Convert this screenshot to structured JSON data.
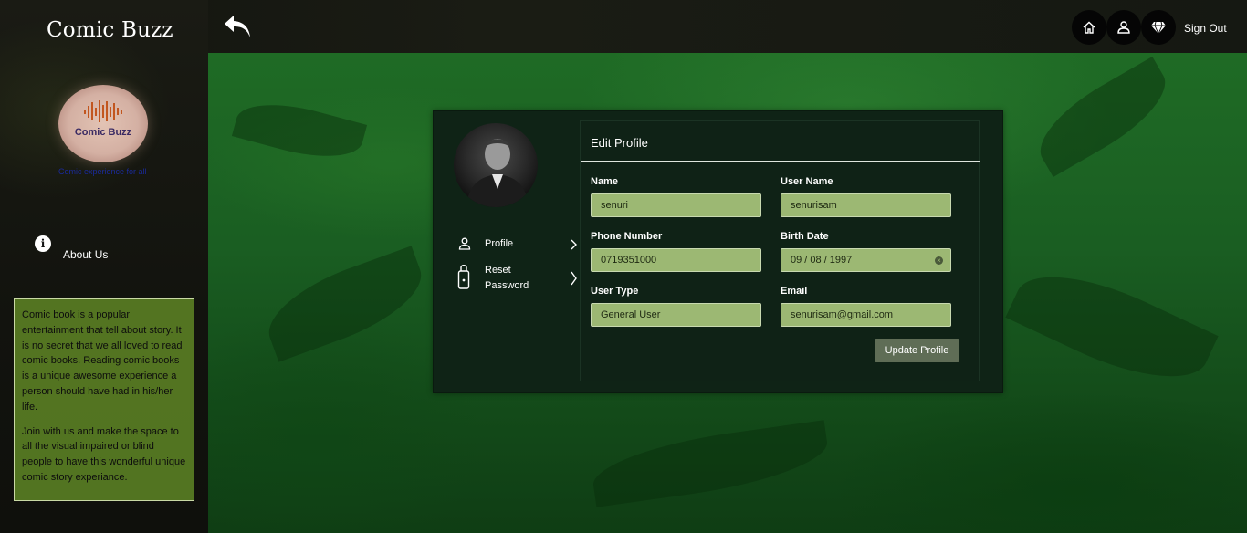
{
  "app": {
    "brand": "Comic Buzz",
    "logo_text": "Comic Buzz",
    "tagline": "Comic experience for all"
  },
  "topbar": {
    "sign_out_label": "Sign Out",
    "icons": [
      "back-arrow-icon",
      "home-icon",
      "user-icon",
      "diamond-icon"
    ]
  },
  "sidebar": {
    "about_label": "About Us",
    "about_paragraphs": [
      "Comic book is a popular entertainment that tell about story. It is no secret that we all loved to read comic books. Reading comic books is a unique awesome experience a person should have had in his/her life.",
      "Join with us and make the space to all the visual impaired or blind people to have this wonderful unique comic story experiance."
    ]
  },
  "profile_menu": {
    "items": [
      {
        "label": "Profile",
        "icon": "user-icon"
      },
      {
        "label": "Reset Password",
        "icon": "lock-icon"
      }
    ]
  },
  "edit_profile": {
    "title": "Edit Profile",
    "fields": {
      "name": {
        "label": "Name",
        "value": "senuri"
      },
      "username": {
        "label": "User Name",
        "value": "senurisam"
      },
      "phone": {
        "label": "Phone Number",
        "value": "0719351000"
      },
      "birth_date": {
        "label": "Birth Date",
        "value": "09 / 08 / 1997"
      },
      "user_type": {
        "label": "User Type",
        "value": "General User"
      },
      "email": {
        "label": "Email",
        "value": "senurisam@gmail.com"
      }
    },
    "submit_label": "Update Profile"
  },
  "colors": {
    "input_bg": "#9cb873",
    "card_bg": "#0f2316",
    "about_box_bg": "#628a26",
    "button_bg": "#5f6d56"
  }
}
